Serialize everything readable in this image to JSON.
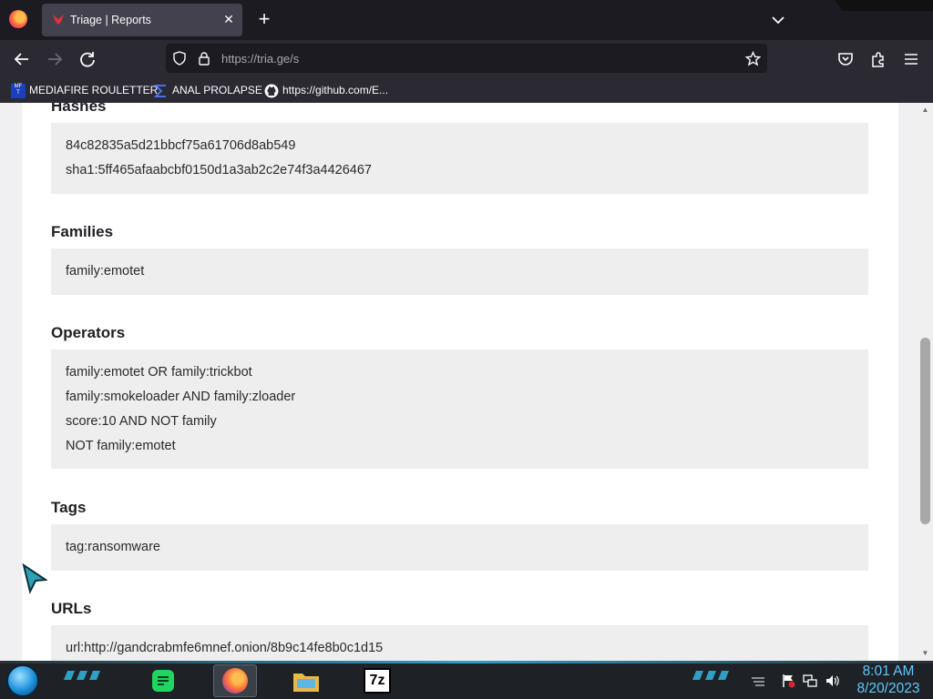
{
  "browser": {
    "tab": {
      "title": "Triage | Reports"
    },
    "url": {
      "host": "https://tria.ge",
      "path": "/s"
    },
    "bookmarks": [
      {
        "label": "MEDIAFIRE ROULETTER",
        "icon": "mediafire-favicon",
        "icon_text": "MF\nT"
      },
      {
        "label": "ANAL PROLAPSE",
        "icon": "sigma-favicon"
      },
      {
        "label": "https://github.com/E...",
        "icon": "github-favicon"
      }
    ]
  },
  "sections": {
    "hashes": {
      "title": "Hashes",
      "lines": [
        "84c82835a5d21bbcf75a61706d8ab549",
        "sha1:5ff465afaabcbf0150d1a3ab2c2e74f3a4426467"
      ]
    },
    "families": {
      "title": "Families",
      "lines": [
        "family:emotet"
      ]
    },
    "operators": {
      "title": "Operators",
      "lines": [
        "family:emotet OR family:trickbot",
        "family:smokeloader AND family:zloader",
        "score:10 AND NOT family",
        "NOT family:emotet"
      ]
    },
    "tags": {
      "title": "Tags",
      "lines": [
        "tag:ransomware"
      ]
    },
    "urls": {
      "title": "URLs",
      "lines": [
        "url:http://gandcrabmfe6mnef.onion/8b9c14fe8b0c1d15"
      ]
    }
  },
  "taskbar": {
    "apps": [
      "start-orb",
      "notes-app-icon",
      "firefox-icon",
      "file-explorer-icon",
      "7zip-icon"
    ],
    "app_7zip_label": "7z",
    "clock": {
      "time": "8:01 AM",
      "date": "8/20/2023"
    }
  },
  "colors": {
    "accent_blue": "#5ec8ff",
    "triage_red": "#e0303b",
    "code_box_bg": "#eeeeee"
  }
}
